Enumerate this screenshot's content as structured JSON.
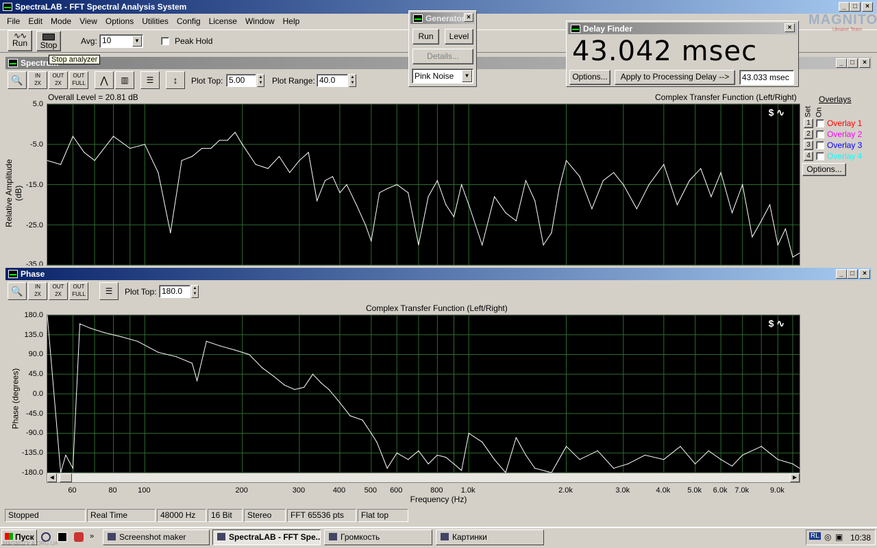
{
  "app": {
    "title": "SpectraLAB - FFT Spectral Analysis System",
    "menu": [
      "File",
      "Edit",
      "Mode",
      "View",
      "Options",
      "Utilities",
      "Config",
      "License",
      "Window",
      "Help"
    ]
  },
  "toolbar": {
    "run_label": "Run",
    "stop_label": "Stop",
    "avg_label": "Avg:",
    "avg_value": "10",
    "peak_hold_label": "Peak Hold",
    "tooltip": "Stop analyzer"
  },
  "generator": {
    "title": "Generator",
    "run_label": "Run",
    "level_label": "Level",
    "details_label": "Details...",
    "signal_value": "Pink Noise"
  },
  "delay_finder": {
    "title": "Delay Finder",
    "value": "43.042 msec",
    "options_label": "Options...",
    "apply_label": "Apply to Processing Delay -->",
    "applied_value": "43.033 msec"
  },
  "watermark": {
    "brand": "MAGNITOLA",
    "sub": "Ukraine Team"
  },
  "spectrum": {
    "title": "Spectrum",
    "plot_top_label": "Plot Top:",
    "plot_top_value": "5.00",
    "plot_range_label": "Plot Range:",
    "plot_range_value": "40.0",
    "overall_level": "Overall Level = 20.81 dB",
    "function_title": "Complex Transfer Function (Left/Right)",
    "ylabel": "Relative Amplitude (dB)",
    "y_ticks": [
      "5.0",
      "-5.0",
      "-15.0",
      "-25.0",
      "-35.0"
    ],
    "overlays": {
      "title": "Overlays",
      "set_label": "Set",
      "on_label": "On",
      "items": [
        {
          "num": "1",
          "label": "Overlay 1",
          "color": "#ff0000"
        },
        {
          "num": "2",
          "label": "Overlay 2",
          "color": "#ff00ff"
        },
        {
          "num": "3",
          "label": "Overlay 3",
          "color": "#0000ff"
        },
        {
          "num": "4",
          "label": "Overlay 4",
          "color": "#00ffff"
        }
      ],
      "options_label": "Options..."
    }
  },
  "phase": {
    "title": "Phase",
    "plot_top_label": "Plot Top:",
    "plot_top_value": "180.0",
    "function_title": "Complex Transfer Function (Left/Right)",
    "ylabel": "Phase (degrees)",
    "y_ticks": [
      "180.0",
      "135.0",
      "90.0",
      "45.0",
      "0.0",
      "-45.0",
      "-90.0",
      "-135.0",
      "-180.0"
    ],
    "xlabel": "Frequency (Hz)",
    "x_ticks": [
      "60",
      "80",
      "100",
      "200",
      "300",
      "400",
      "500",
      "600",
      "800",
      "1.0k",
      "2.0k",
      "3.0k",
      "4.0k",
      "5.0k",
      "6.0k",
      "7.0k",
      "9.0k"
    ]
  },
  "chart_data": [
    {
      "type": "line",
      "title": "Complex Transfer Function (Left/Right)",
      "ylabel": "Relative Amplitude (dB)",
      "xlabel": "Frequency (Hz)",
      "x_scale": "log",
      "xlim": [
        50,
        10500
      ],
      "ylim": [
        -35,
        5
      ],
      "grid": true,
      "x": [
        50,
        55,
        60,
        65,
        70,
        80,
        90,
        100,
        110,
        120,
        130,
        140,
        150,
        160,
        170,
        180,
        190,
        200,
        220,
        240,
        260,
        280,
        300,
        320,
        340,
        360,
        380,
        400,
        420,
        450,
        480,
        500,
        530,
        560,
        600,
        650,
        700,
        750,
        800,
        850,
        900,
        950,
        1000,
        1100,
        1200,
        1300,
        1400,
        1500,
        1600,
        1700,
        1800,
        1900,
        2000,
        2200,
        2400,
        2600,
        2800,
        3000,
        3300,
        3600,
        4000,
        4400,
        4800,
        5200,
        5600,
        6000,
        6500,
        7000,
        7500,
        8000,
        8500,
        9000,
        9500,
        10000,
        10500
      ],
      "y": [
        -9,
        -10,
        -3,
        -7,
        -9,
        -3,
        -6,
        -5,
        -12,
        -27,
        -9,
        -8,
        -6,
        -6,
        -4,
        -4,
        -2,
        -5,
        -10,
        -11,
        -8,
        -12,
        -9,
        -7,
        -19,
        -14,
        -13,
        -17,
        -15,
        -20,
        -25,
        -29,
        -17,
        -16,
        -15,
        -17,
        -30,
        -18,
        -14,
        -20,
        -23,
        -15,
        -20,
        -30,
        -18,
        -22,
        -24,
        -14,
        -19,
        -30,
        -27,
        -16,
        -9,
        -13,
        -21,
        -14,
        -12,
        -15,
        -21,
        -15,
        -10,
        -20,
        -14,
        -11,
        -18,
        -12,
        -22,
        -15,
        -28,
        -24,
        -20,
        -30,
        -26,
        -33,
        -32
      ]
    },
    {
      "type": "line",
      "title": "Complex Transfer Function (Left/Right)",
      "ylabel": "Phase (degrees)",
      "xlabel": "Frequency (Hz)",
      "x_scale": "log",
      "xlim": [
        50,
        10500
      ],
      "ylim": [
        -180,
        180
      ],
      "grid": true,
      "x": [
        50,
        55,
        57,
        60,
        63,
        68,
        75,
        85,
        95,
        110,
        125,
        140,
        145,
        155,
        170,
        190,
        210,
        230,
        250,
        270,
        290,
        310,
        330,
        350,
        370,
        400,
        430,
        470,
        500,
        520,
        540,
        560,
        600,
        650,
        700,
        750,
        800,
        850,
        900,
        950,
        1000,
        1100,
        1200,
        1300,
        1400,
        1500,
        1600,
        1800,
        2000,
        2200,
        2500,
        2800,
        3100,
        3500,
        4000,
        4500,
        5000,
        5500,
        6000,
        6500,
        7000,
        8000,
        9000,
        10000,
        10500
      ],
      "y": [
        180,
        -180,
        -140,
        -170,
        160,
        150,
        140,
        130,
        120,
        95,
        85,
        70,
        30,
        120,
        110,
        100,
        90,
        60,
        40,
        20,
        10,
        15,
        45,
        25,
        10,
        -20,
        -50,
        -60,
        -90,
        -110,
        -140,
        -170,
        -135,
        -150,
        -130,
        -160,
        -140,
        -145,
        -160,
        -175,
        -90,
        -110,
        -150,
        -180,
        -100,
        -140,
        -170,
        -180,
        -120,
        -150,
        -130,
        -170,
        -160,
        -140,
        -150,
        -120,
        -160,
        -130,
        -150,
        -165,
        -140,
        -120,
        -150,
        -160,
        -170
      ]
    }
  ],
  "status_bar": [
    "Stopped",
    "Real Time",
    "48000 Hz",
    "16 Bit",
    "Stereo",
    "FFT 65536 pts",
    "Flat top"
  ],
  "taskbar": {
    "start_label": "Пуск",
    "tasks": [
      "Screenshot maker",
      "SpectraLAB - FFT Spe...",
      "Громкость",
      "Картинки"
    ],
    "tray_lang": "RL",
    "clock": "10:38",
    "hint": "MAGNITOLA.ORG.UA"
  }
}
